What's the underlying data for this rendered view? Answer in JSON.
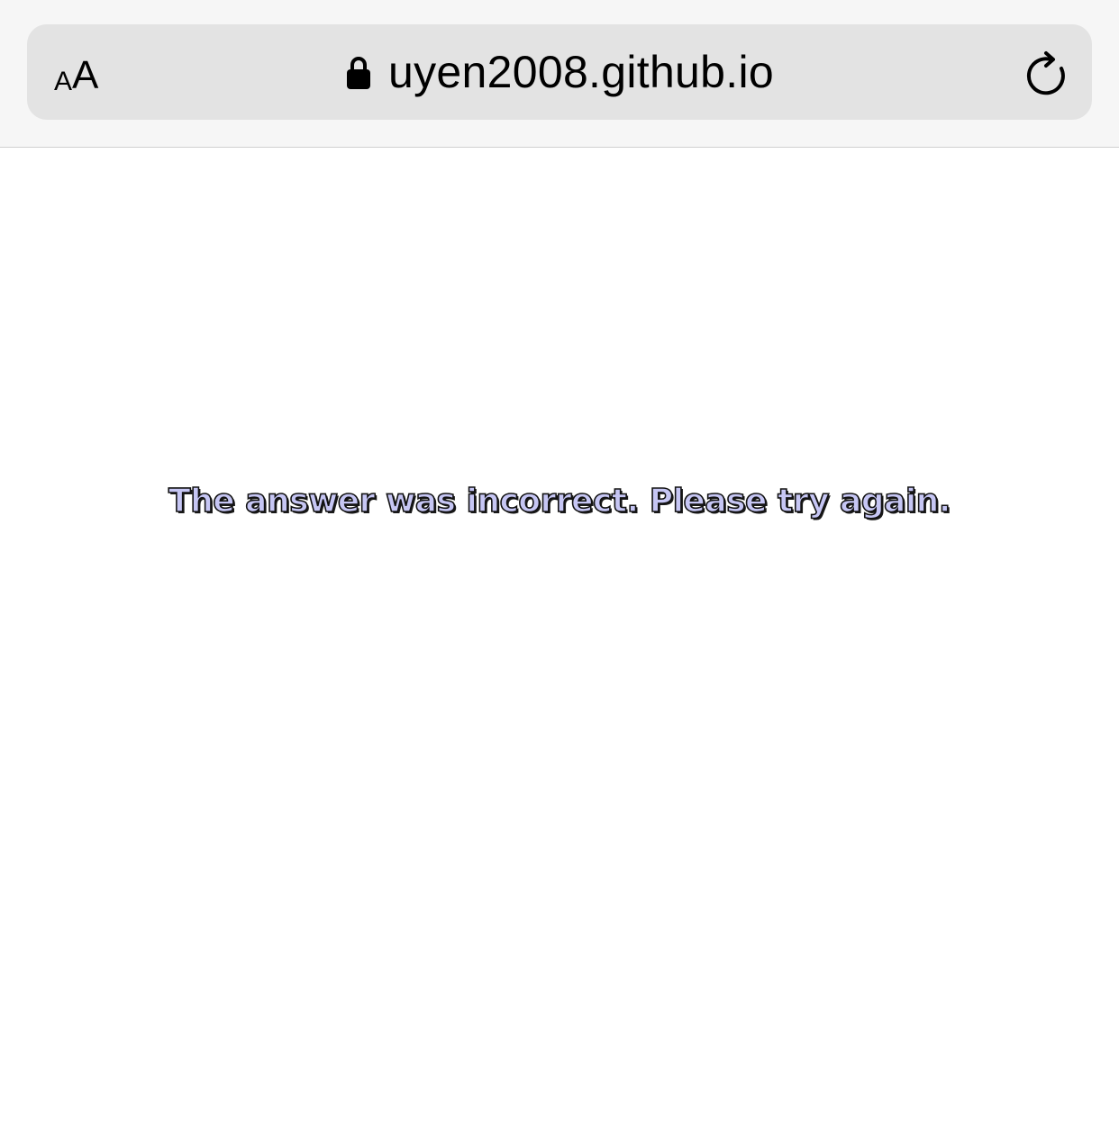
{
  "browser": {
    "text_size_button": {
      "small": "A",
      "big": "A"
    },
    "address": "uyen2008.github.io",
    "icons": {
      "lock": "lock-icon",
      "reload": "reload-icon"
    }
  },
  "page": {
    "message": "The answer was incorrect. Please try again.",
    "colors": {
      "message_fill": "#c6c6f4",
      "message_outline": "#111111",
      "toolbar_bg": "#f6f6f6",
      "urlbar_bg": "#e3e3e3"
    }
  }
}
